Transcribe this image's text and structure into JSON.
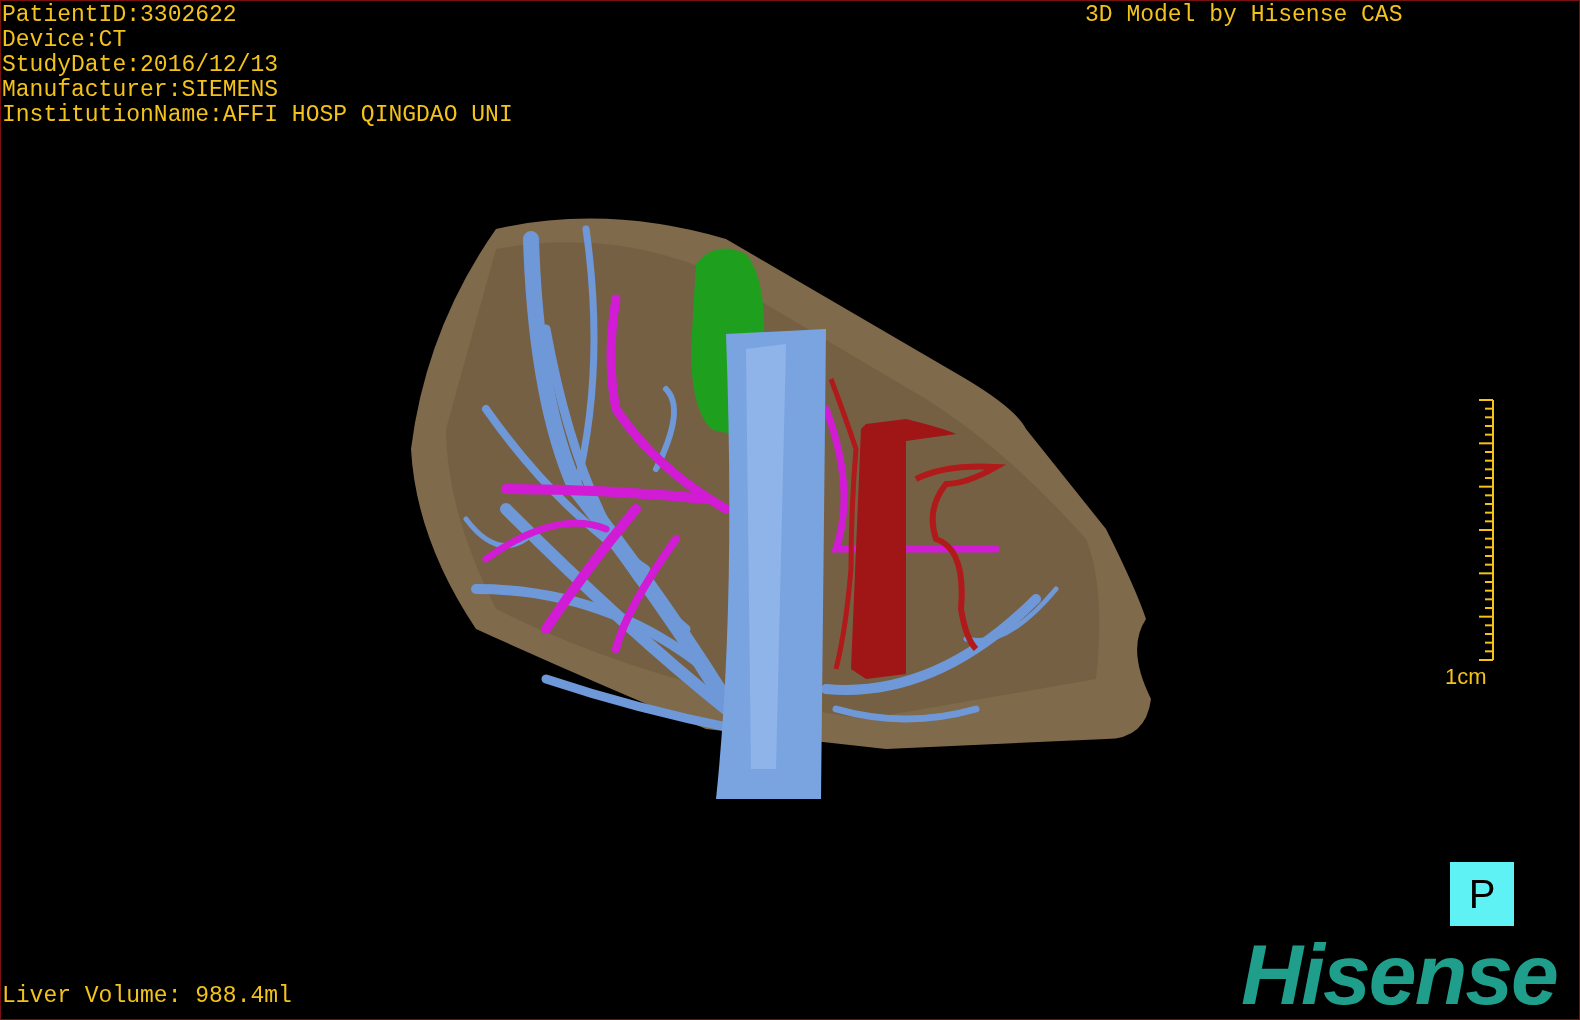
{
  "patient_info": [
    "PatientID:3302622",
    "Device:CT",
    "StudyDate:2016/12/13",
    "Manufacturer:SIEMENS",
    "InstitutionName:AFFI HOSP QINGDAO UNI"
  ],
  "header_right": "3D Model by Hisense CAS",
  "scale_bar": {
    "label": "1cm"
  },
  "view_button": {
    "label": "P"
  },
  "liver_volume": "Liver Volume: 988.4ml",
  "logo": "Hisense"
}
